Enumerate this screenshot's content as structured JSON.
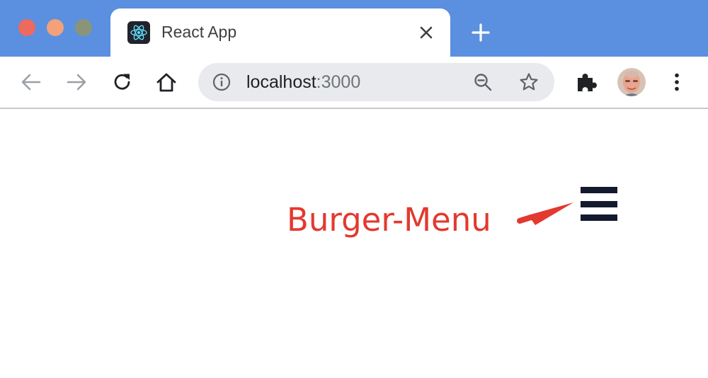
{
  "browser": {
    "tab": {
      "title": "React App",
      "favicon": "react-logo-icon"
    },
    "address_bar": {
      "host": "localhost",
      "port": ":3000"
    },
    "icons": [
      "back-arrow-icon",
      "forward-arrow-icon",
      "reload-icon",
      "home-icon",
      "info-icon",
      "zoom-out-icon",
      "bookmark-star-icon",
      "extensions-puzzle-icon",
      "profile-avatar",
      "menu-kebab-icon",
      "new-tab-plus-icon",
      "tab-close-icon"
    ],
    "colors": {
      "tabstrip": "#5b8fe0",
      "omnibox": "#e8eaed"
    }
  },
  "page": {
    "annotation": {
      "text": "Burger-Menu",
      "color": "#e3392f"
    },
    "burger_menu": {
      "icon": "hamburger-menu-icon",
      "color": "#131a2e"
    }
  }
}
